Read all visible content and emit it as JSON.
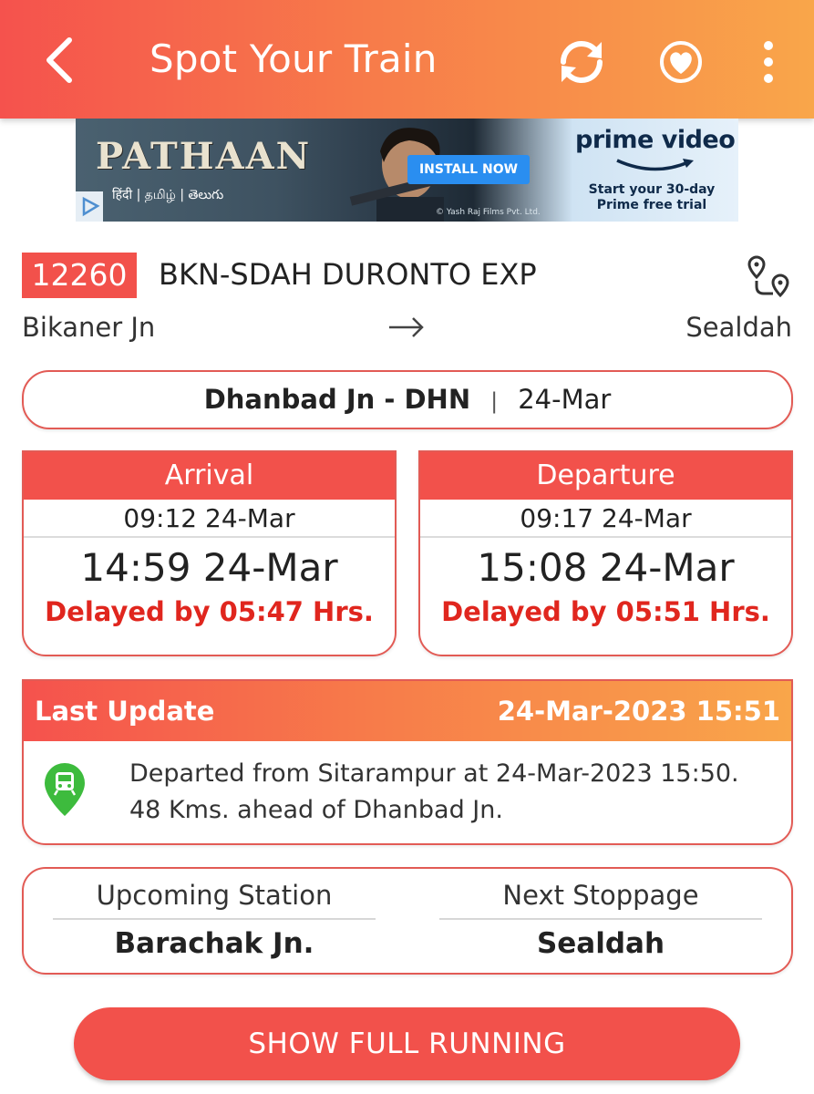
{
  "header": {
    "title": "Spot Your Train",
    "icons": [
      "back-arrow-icon",
      "refresh-icon",
      "favorite-heart-icon",
      "more-vert-icon"
    ]
  },
  "ad": {
    "movie": "PATHAAN",
    "languages": "हिंदी | தமிழ் | తెలుగు",
    "install_label": "INSTALL NOW",
    "copyright": "© Yash Raj Films Pvt. Ltd.",
    "brand": "prime video",
    "trial_line1": "Start your 30-day",
    "trial_line2": "Prime free trial"
  },
  "train": {
    "number": "12260",
    "name": "BKN-SDAH DURONTO EXP",
    "from": "Bikaner Jn",
    "to": "Sealdah"
  },
  "station": {
    "name": "Dhanbad Jn - DHN",
    "separator": "|",
    "date": "24-Mar"
  },
  "arrival": {
    "label": "Arrival",
    "scheduled": "09:12 24-Mar",
    "actual": "14:59 24-Mar",
    "delay": "Delayed by 05:47 Hrs."
  },
  "departure": {
    "label": "Departure",
    "scheduled": "09:17 24-Mar",
    "actual": "15:08 24-Mar",
    "delay": "Delayed by 05:51 Hrs."
  },
  "last_update": {
    "label": "Last Update",
    "timestamp": "24-Mar-2023 15:51",
    "line1": "Departed from Sitarampur at 24-Mar-2023 15:50.",
    "line2": "48 Kms. ahead of Dhanbad Jn."
  },
  "upcoming": {
    "label": "Upcoming Station",
    "value": "Barachak Jn."
  },
  "next_stoppage": {
    "label": "Next Stoppage",
    "value": "Sealdah"
  },
  "show_full_running_label": "SHOW FULL RUNNING",
  "colors": {
    "primary_red": "#f2514b",
    "gradient_orange": "#f9a64a",
    "delay_red": "#e0261e",
    "pin_green": "#3dbb3d"
  }
}
